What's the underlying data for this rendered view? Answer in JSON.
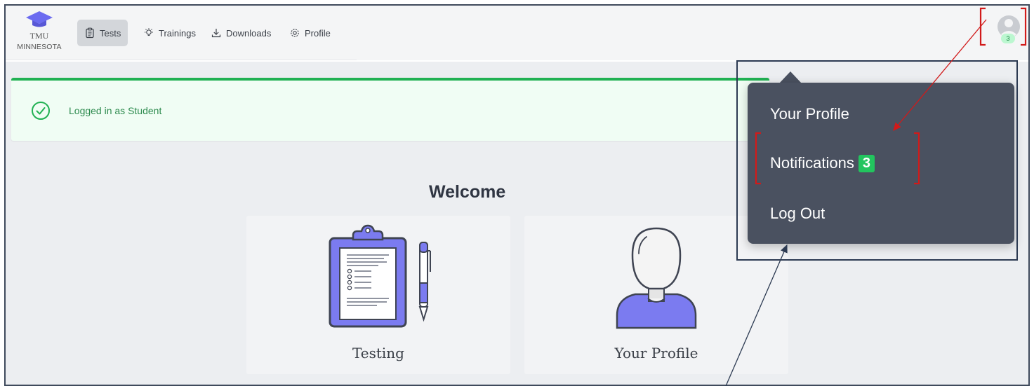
{
  "brand": {
    "line1": "TMU",
    "line2": "MINNESOTA",
    "accent": "#6b6bf0"
  },
  "nav": [
    {
      "label": "Tests",
      "icon": "clipboard-icon",
      "active": true
    },
    {
      "label": "Trainings",
      "icon": "lightbulb-icon",
      "active": false
    },
    {
      "label": "Downloads",
      "icon": "download-icon",
      "active": false
    },
    {
      "label": "Profile",
      "icon": "gear-icon",
      "active": false
    }
  ],
  "alert": {
    "message": "Logged in as Student",
    "icon": "check-circle-icon",
    "color": "#21b153"
  },
  "welcome": "Welcome",
  "cards": [
    {
      "caption": "Testing",
      "icon": "clipboard-illustration"
    },
    {
      "caption": "Your Profile",
      "icon": "person-illustration"
    }
  ],
  "user_menu": {
    "items": [
      {
        "label": "Your Profile"
      },
      {
        "label": "Notifications",
        "badge": "3"
      },
      {
        "label": "Log Out"
      }
    ],
    "badge_color": "#22c55e"
  },
  "avatar": {
    "notification_count": "3"
  },
  "annotation_colors": {
    "highlight": "#d11a1a",
    "callout": "#2c3a52"
  }
}
